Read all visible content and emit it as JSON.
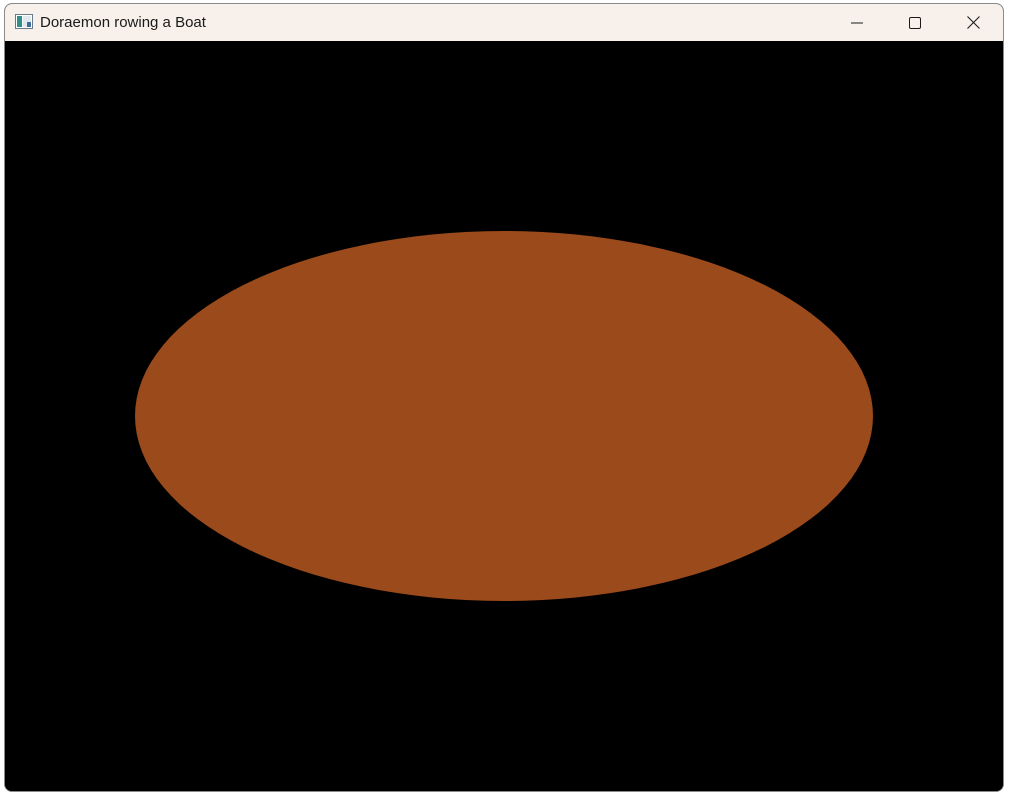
{
  "window": {
    "title": "Doraemon rowing a Boat",
    "app_icon": "app-window-icon",
    "controls": {
      "minimize_icon": "minimize-icon",
      "maximize_icon": "maximize-icon",
      "close_icon": "close-icon"
    }
  },
  "canvas": {
    "background_color": "#000000",
    "boat_color": "#9a4a1b"
  }
}
